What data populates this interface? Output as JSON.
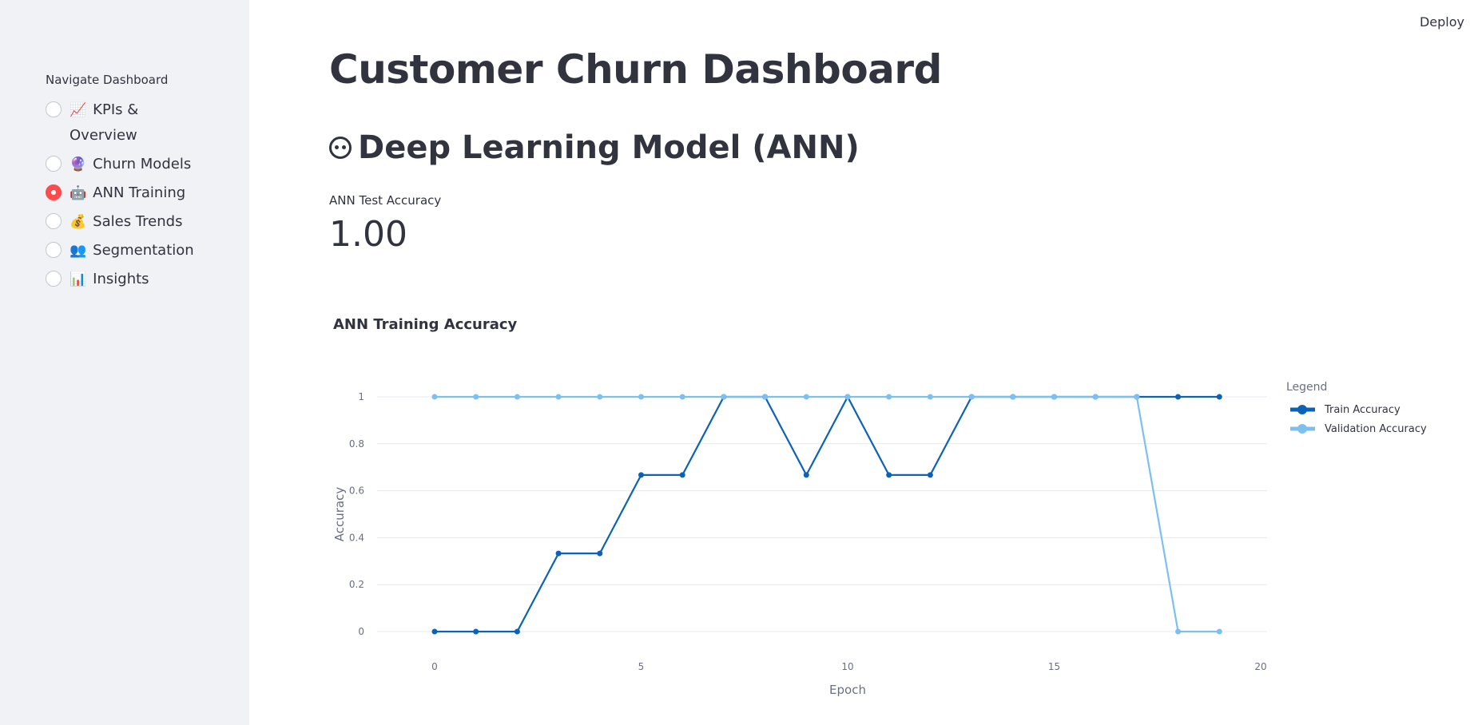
{
  "header": {
    "deploy_label": "Deploy"
  },
  "sidebar": {
    "heading": "Navigate Dashboard",
    "items": [
      {
        "emoji": "📈",
        "label": "KPIs & Overview",
        "selected": false
      },
      {
        "emoji": "🔮",
        "label": "Churn Models",
        "selected": false
      },
      {
        "emoji": "🤖",
        "label": "ANN Training",
        "selected": true
      },
      {
        "emoji": "💰",
        "label": "Sales Trends",
        "selected": false
      },
      {
        "emoji": "👥",
        "label": "Segmentation",
        "selected": false
      },
      {
        "emoji": "📊",
        "label": "Insights",
        "selected": false
      }
    ]
  },
  "main": {
    "title": "Customer Churn Dashboard",
    "subtitle": "Deep Learning Model (ANN)",
    "metric": {
      "label": "ANN Test Accuracy",
      "value": "1.00"
    }
  },
  "colors": {
    "accent": "#ff4b4b",
    "train": "#0a63b8",
    "validation": "#7cc0f2"
  },
  "chart_data": {
    "type": "line",
    "title": "ANN Training Accuracy",
    "xlabel": "Epoch",
    "ylabel": "Accuracy",
    "xlim": [
      -2.5,
      20
    ],
    "ylim": [
      0,
      1
    ],
    "x_ticks": [
      0,
      5,
      10,
      15,
      20
    ],
    "y_ticks": [
      0,
      0.2,
      0.4,
      0.6,
      0.8,
      1
    ],
    "legend_title": "Legend",
    "legend_position": "right",
    "x": [
      0,
      1,
      2,
      3,
      4,
      5,
      6,
      7,
      8,
      9,
      10,
      11,
      12,
      13,
      14,
      15,
      16,
      17,
      18,
      19
    ],
    "series": [
      {
        "name": "Train Accuracy",
        "color": "#0a63b8",
        "values": [
          0,
          0,
          0,
          0.333,
          0.333,
          0.667,
          0.667,
          1,
          1,
          0.667,
          1,
          0.667,
          0.667,
          1,
          1,
          1,
          1,
          1,
          1,
          1
        ]
      },
      {
        "name": "Validation Accuracy",
        "color": "#7cc0f2",
        "values": [
          1,
          1,
          1,
          1,
          1,
          1,
          1,
          1,
          1,
          1,
          1,
          1,
          1,
          1,
          1,
          1,
          1,
          1,
          0,
          0
        ]
      }
    ]
  }
}
